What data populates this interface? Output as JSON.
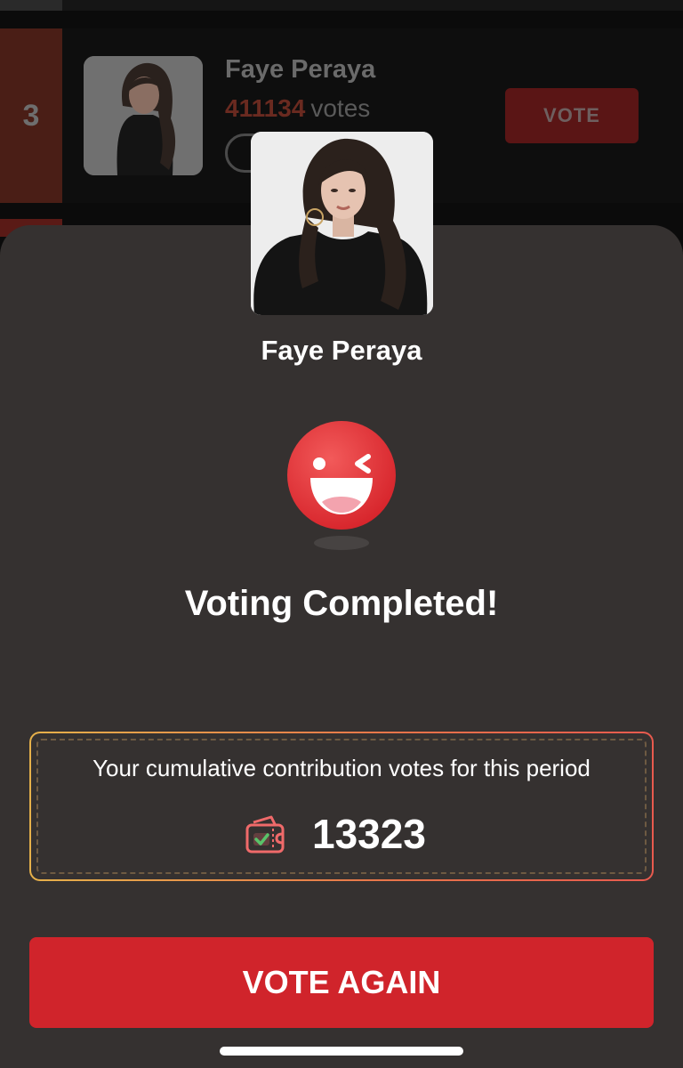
{
  "background_list": {
    "row": {
      "rank": "3",
      "name": "Faye Peraya",
      "votes_count": "411134",
      "votes_unit": "votes",
      "vote_button_label": "VOTE"
    }
  },
  "modal": {
    "candidate_name": "Faye Peraya",
    "status_title": "Voting Completed!",
    "contribution": {
      "label": "Your cumulative contribution votes for this period",
      "value": "13323",
      "icon": "ticket-check-icon"
    },
    "primary_button_label": "VOTE AGAIN"
  },
  "colors": {
    "accent_red": "#d0242b",
    "sheet_background": "#353130",
    "gradient_start": "#e6b14a",
    "gradient_end": "#e85a4e"
  }
}
